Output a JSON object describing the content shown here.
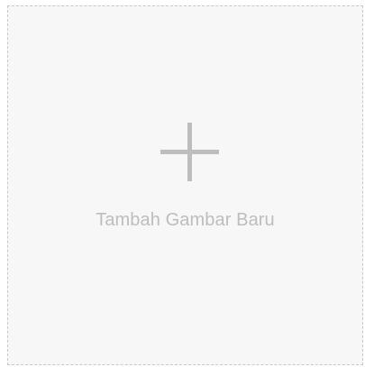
{
  "upload": {
    "icon": "plus-icon",
    "label": "Tambah Gambar Baru",
    "border_color": "#c8c8c8",
    "background_color": "#f7f7f7",
    "content_color": "#bdbdbd"
  }
}
